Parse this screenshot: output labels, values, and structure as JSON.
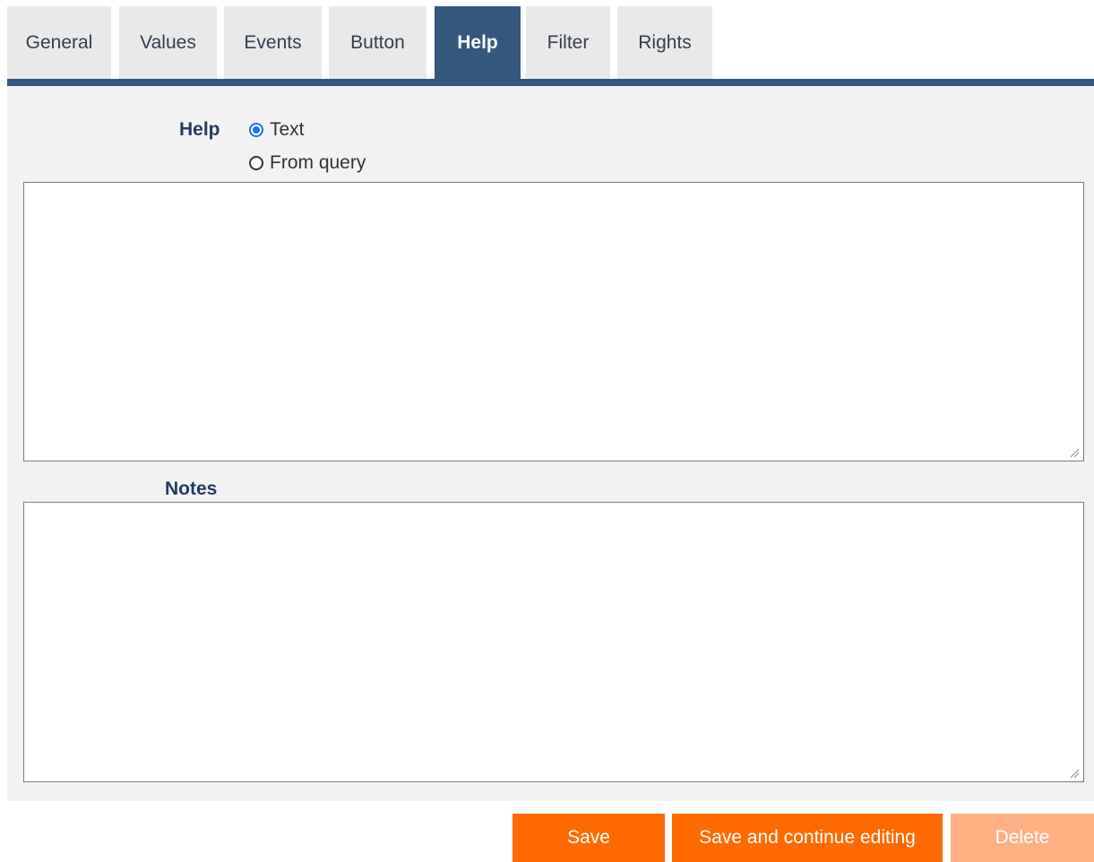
{
  "tabs": [
    {
      "label": "General"
    },
    {
      "label": "Values"
    },
    {
      "label": "Events"
    },
    {
      "label": "Button"
    },
    {
      "label": "Help",
      "active": true
    },
    {
      "label": "Filter"
    },
    {
      "label": "Rights"
    }
  ],
  "help": {
    "label": "Help",
    "options": [
      {
        "label": "Text",
        "selected": true
      },
      {
        "label": "From query",
        "selected": false
      }
    ],
    "value": ""
  },
  "notes": {
    "label": "Notes",
    "value": ""
  },
  "actions": {
    "save_label": "Save",
    "save_continue_label": "Save and continue editing",
    "delete_label": "Delete"
  },
  "colors": {
    "accent": "#34577f",
    "button_primary": "#ff6a00",
    "button_disabled": "#ffb183",
    "label": "#243b5e",
    "panel": "#f2f2f2",
    "tab_inactive": "#e9e9e9"
  }
}
